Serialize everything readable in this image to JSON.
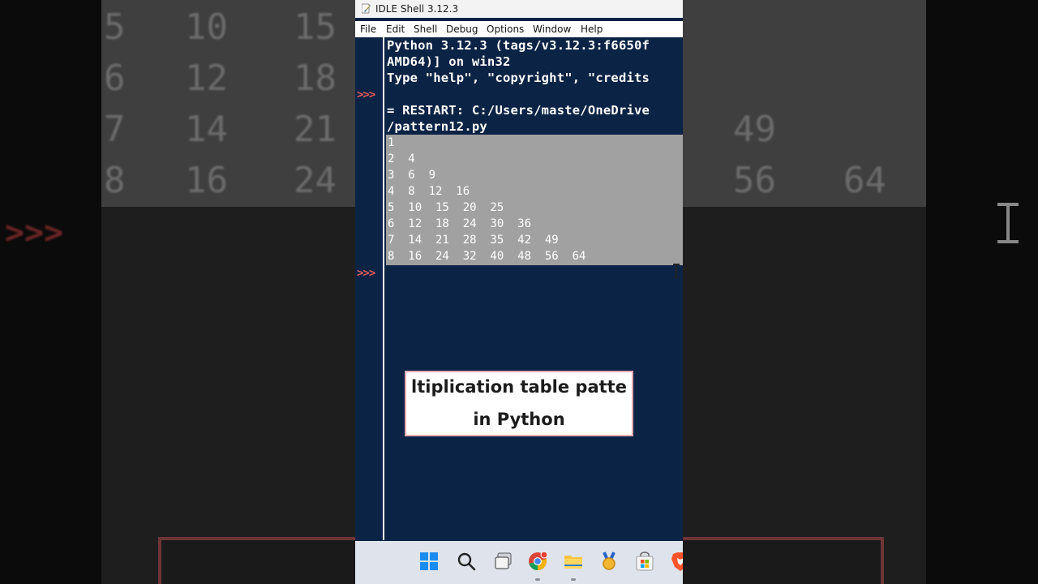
{
  "window": {
    "title": "IDLE Shell 3.12.3"
  },
  "menu": [
    "File",
    "Edit",
    "Shell",
    "Debug",
    "Options",
    "Window",
    "Help"
  ],
  "shell": {
    "prompt": ">>>",
    "banner": [
      "Python 3.12.3 (tags/v3.12.3:f6650f",
      "AMD64)] on win32",
      "Type \"help\", \"copyright\", \"credits"
    ],
    "restart": [
      "= RESTART: C:/Users/maste/OneDrive",
      "/pattern12.py"
    ],
    "output": [
      "1",
      "2  4",
      "3  6  9",
      "4  8  12  16",
      "5  10  15  20  25",
      "6  12  18  24  30  36",
      "7  14  21  28  35  42  49",
      "8  16  24  32  40  48  56  64"
    ]
  },
  "caption": {
    "line1": "ltiplication table patte",
    "line2": "in Python",
    "border_color": "#e8a8b0"
  },
  "background": {
    "left_rows": [
      [
        "5",
        "10",
        "15"
      ],
      [
        "6",
        "12",
        "18"
      ],
      [
        "7",
        "14",
        "21"
      ],
      [
        "8",
        "16",
        "24"
      ]
    ],
    "right_rows": [
      [
        "49"
      ],
      [
        "56",
        "64"
      ]
    ],
    "prompt": ">>>"
  },
  "taskbar": {
    "icons": [
      "windows-start-icon",
      "search-icon",
      "task-view-icon",
      "chrome-icon",
      "file-explorer-icon",
      "medal-icon",
      "store-icon",
      "brave-icon"
    ]
  },
  "colors": {
    "shell_bg": "#0b2345",
    "selection": "#a1a1a1",
    "prompt": "#e05a5a"
  }
}
